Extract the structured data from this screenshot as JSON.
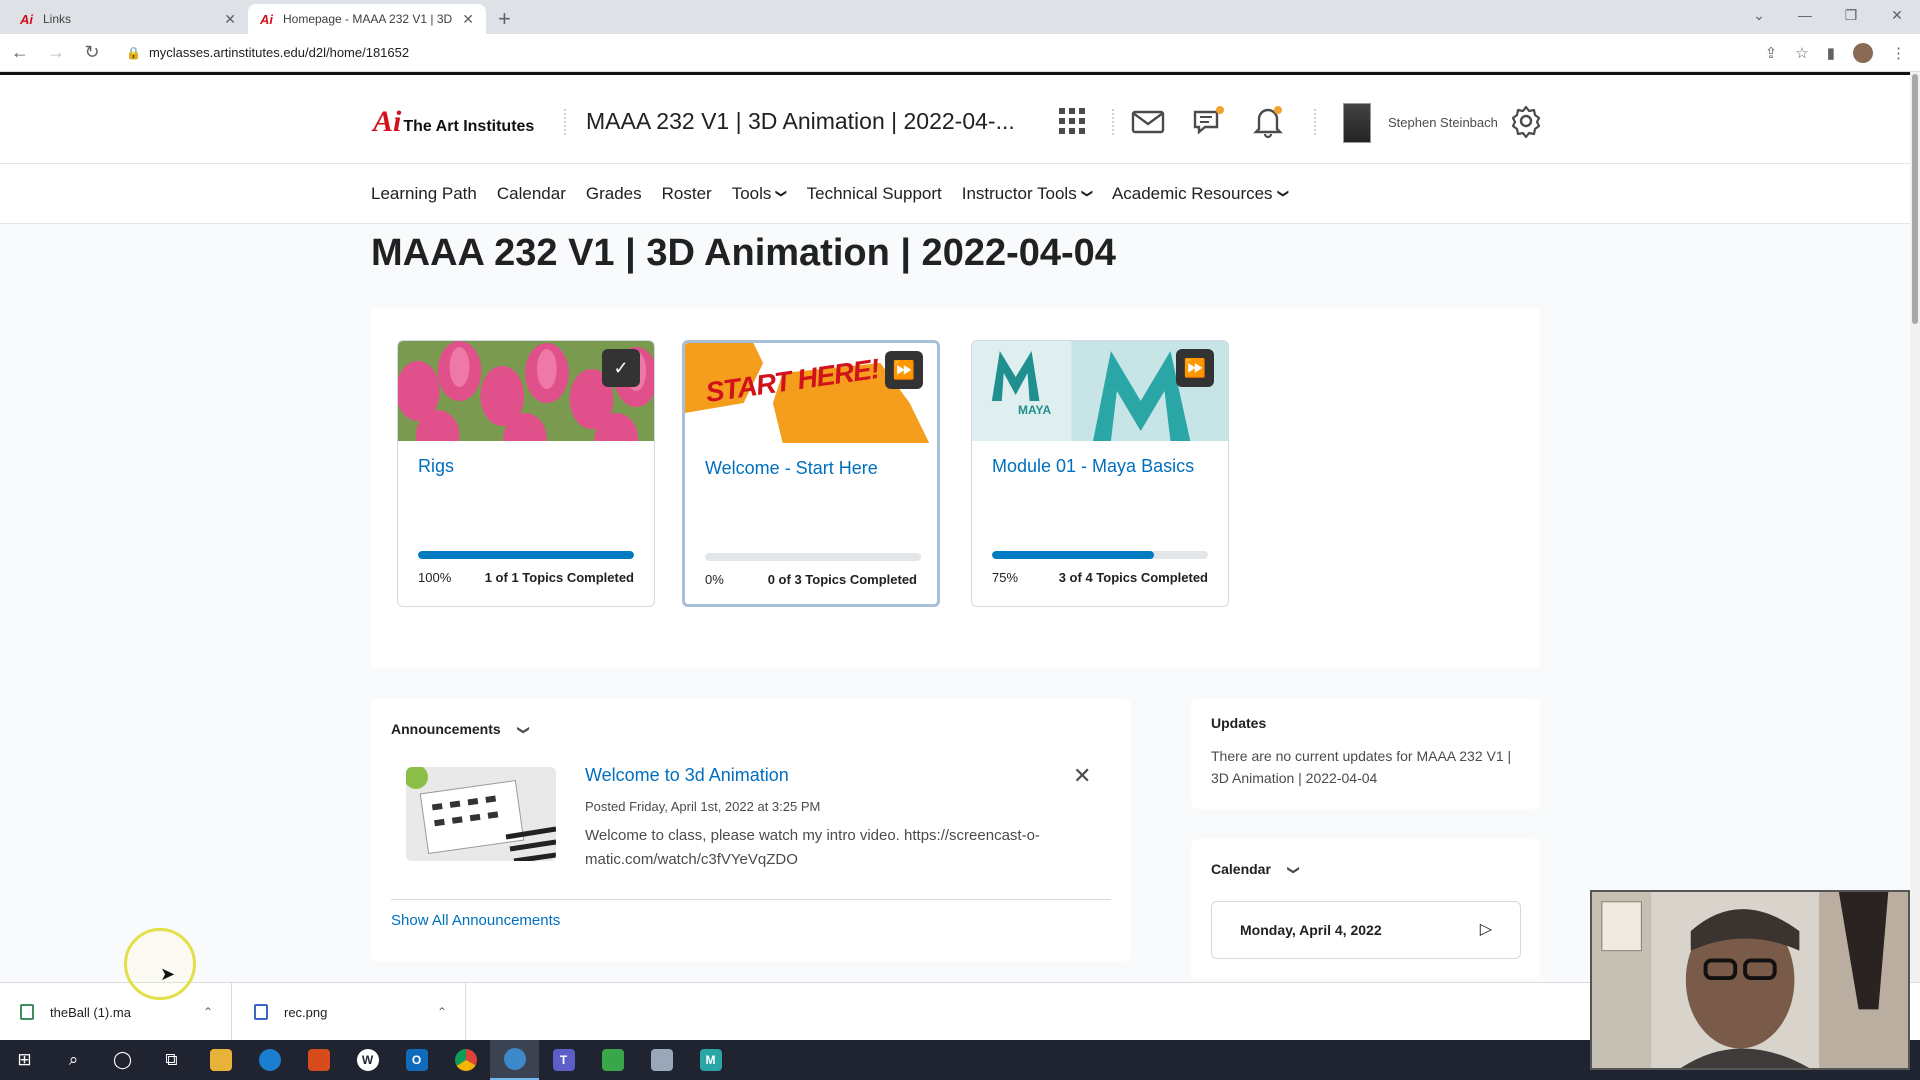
{
  "browser": {
    "tabs": [
      {
        "title": "Links",
        "active": false
      },
      {
        "title": "Homepage - MAAA 232 V1 | 3D",
        "active": true
      }
    ],
    "url": "myclasses.artinstitutes.edu/d2l/home/181652"
  },
  "header": {
    "logo_text": "The Art Institutes",
    "course_title": "MAAA 232 V1 | 3D Animation | 2022-04-...",
    "user_name": "Stephen Steinbach"
  },
  "nav": {
    "items": [
      {
        "label": "Learning Path",
        "dropdown": false
      },
      {
        "label": "Calendar",
        "dropdown": false
      },
      {
        "label": "Grades",
        "dropdown": false
      },
      {
        "label": "Roster",
        "dropdown": false
      },
      {
        "label": "Tools",
        "dropdown": true
      },
      {
        "label": "Technical Support",
        "dropdown": false
      },
      {
        "label": "Instructor Tools",
        "dropdown": true
      },
      {
        "label": "Academic Resources",
        "dropdown": true
      }
    ]
  },
  "page": {
    "title": "MAAA 232 V1 | 3D Animation | 2022-04-04"
  },
  "learning_path": [
    {
      "name": "Rigs",
      "progress": 100,
      "percent_label": "100%",
      "completed_label": "1 of 1 Topics Completed",
      "badge": "check-icon"
    },
    {
      "name": "Welcome - Start Here",
      "progress": 0,
      "percent_label": "0%",
      "completed_label": "0 of 3 Topics Completed",
      "badge": "fast-forward-icon",
      "image_text": "START HERE!"
    },
    {
      "name": "Module 01 - Maya Basics",
      "progress": 75,
      "percent_label": "75%",
      "completed_label": "3 of 4 Topics Completed",
      "badge": "fast-forward-icon",
      "image_text": "MAYA"
    }
  ],
  "announcements": {
    "title": "Announcements",
    "item": {
      "title": "Welcome to 3d Animation",
      "posted": "Posted Friday, April 1st, 2022 at 3:25 PM",
      "body": "Welcome to class, please watch my intro video. https://screencast-o-matic.com/watch/c3fVYeVqZDO"
    },
    "show_all": "Show All Announcements"
  },
  "updates": {
    "title": "Updates",
    "text": "There are no current updates for MAAA 232 V1 | 3D Animation | 2022-04-04"
  },
  "calendar": {
    "title": "Calendar",
    "date": "Monday, April 4, 2022"
  },
  "downloads": [
    {
      "name": "theBall (1).ma"
    },
    {
      "name": "rec.png"
    }
  ],
  "colors": {
    "accent": "#006fbf",
    "progress": "#007bc1",
    "brand_red": "#d0121b"
  }
}
